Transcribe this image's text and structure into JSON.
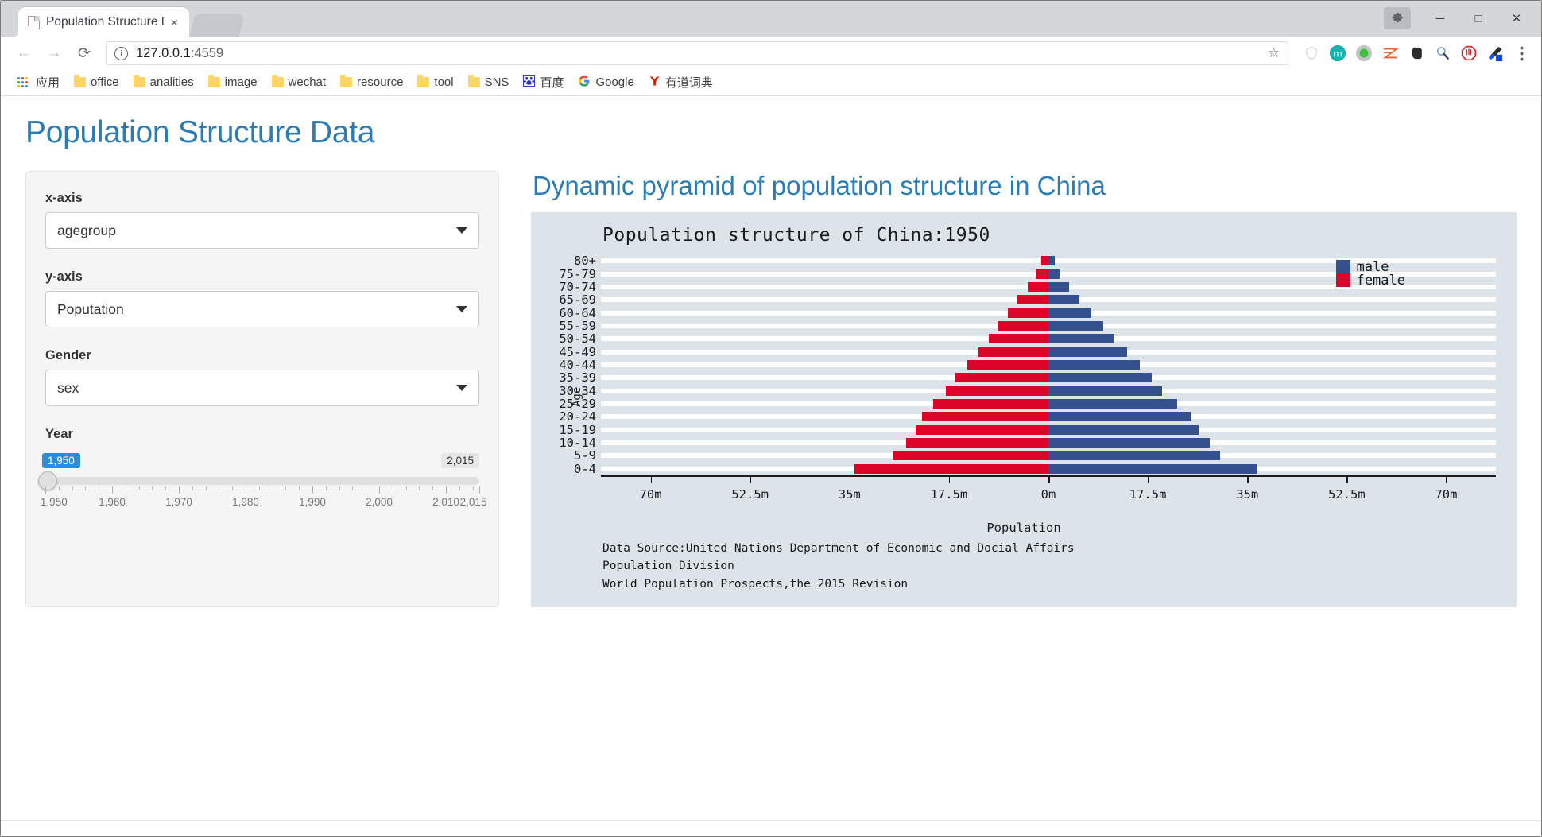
{
  "browser": {
    "tab": {
      "title": "Population Structure D",
      "close_label": "×",
      "favicon": "page-icon"
    },
    "nav": {
      "back": "←",
      "forward": "→",
      "reload": "⟳",
      "url_main": "127.0.0.1",
      "url_port": ":4559",
      "star": "☆",
      "info_icon": "ⓘ"
    },
    "window": {
      "minimize": "─",
      "maximize": "□",
      "close": "✕",
      "extension_badge": "puzzle-icon"
    },
    "toolbar_icons": [
      "shield-icon",
      "mendeley-icon",
      "green-dot-icon",
      "zotero-icon",
      "evernote-icon",
      "search-ext-icon",
      "adblock-icon",
      "eyedropper-icon",
      "menu-icon"
    ],
    "bookmarks": [
      {
        "label": "应用",
        "icon": "apps-grid-icon"
      },
      {
        "label": "office",
        "icon": "folder-icon"
      },
      {
        "label": "analities",
        "icon": "folder-icon"
      },
      {
        "label": "image",
        "icon": "folder-icon"
      },
      {
        "label": "wechat",
        "icon": "folder-icon"
      },
      {
        "label": "resource",
        "icon": "folder-icon"
      },
      {
        "label": "tool",
        "icon": "folder-icon"
      },
      {
        "label": "SNS",
        "icon": "folder-icon"
      },
      {
        "label": "百度",
        "icon": "baidu-icon"
      },
      {
        "label": "Google",
        "icon": "google-icon"
      },
      {
        "label": "有道词典",
        "icon": "youdao-icon"
      }
    ]
  },
  "page": {
    "title": "Population Structure Data"
  },
  "sidebar": {
    "xaxis": {
      "label": "x-axis",
      "value": "agegroup"
    },
    "yaxis": {
      "label": "y-axis",
      "value": "Poputation"
    },
    "gender": {
      "label": "Gender",
      "value": "sex"
    },
    "year": {
      "label": "Year",
      "from": "1,950",
      "to": "2,015",
      "ticks": [
        "1,950",
        "1,960",
        "1,970",
        "1,980",
        "1,990",
        "2,000",
        "2,010",
        "2,015"
      ]
    }
  },
  "chart_heading": "Dynamic pyramid of population structure in China",
  "chart_data": {
    "type": "bar",
    "subtype": "population-pyramid",
    "title": "Population structure of China:1950",
    "xlabel": "Population",
    "ylabel": "Age",
    "grid": true,
    "legend_position": "top-right",
    "xlim": [
      -78.75,
      78.75
    ],
    "xtick_values": [
      -70,
      -52.5,
      -35,
      -17.5,
      0,
      17.5,
      35,
      52.5,
      70
    ],
    "xtick_labels": [
      "70m",
      "52.5m",
      "35m",
      "17.5m",
      "0m",
      "17.5m",
      "35m",
      "52.5m",
      "70m"
    ],
    "units": "millions",
    "categories": [
      "0-4",
      "5-9",
      "10-14",
      "15-19",
      "20-24",
      "25-29",
      "30-34",
      "35-39",
      "40-44",
      "45-49",
      "50-54",
      "55-59",
      "60-64",
      "65-69",
      "70-74",
      "75-79",
      "80+"
    ],
    "series": [
      {
        "name": "male",
        "color": "#34508f",
        "values": [
          36.8,
          30.2,
          28.4,
          26.5,
          25.0,
          22.6,
          20.0,
          18.2,
          16.1,
          13.8,
          11.6,
          9.6,
          7.6,
          5.5,
          3.6,
          2.0,
          1.1
        ]
      },
      {
        "name": "female",
        "color": "#dc0428",
        "values": [
          34.1,
          27.4,
          25.1,
          23.4,
          22.3,
          20.3,
          18.1,
          16.3,
          14.3,
          12.3,
          10.5,
          8.9,
          7.2,
          5.4,
          3.7,
          2.2,
          1.3
        ]
      }
    ],
    "source_lines": [
      "Data Source:United Nations Department of Economic and Docial Affairs",
      "Population Division",
      "World Population Prospects,the 2015 Revision"
    ]
  },
  "colors": {
    "male": "#34508f",
    "female": "#dc0428",
    "chart_bg": "#dce4ea",
    "accent": "#2b7cb5",
    "panel_bg": "#f5f5f5",
    "slider_active": "#2c8ed6"
  }
}
